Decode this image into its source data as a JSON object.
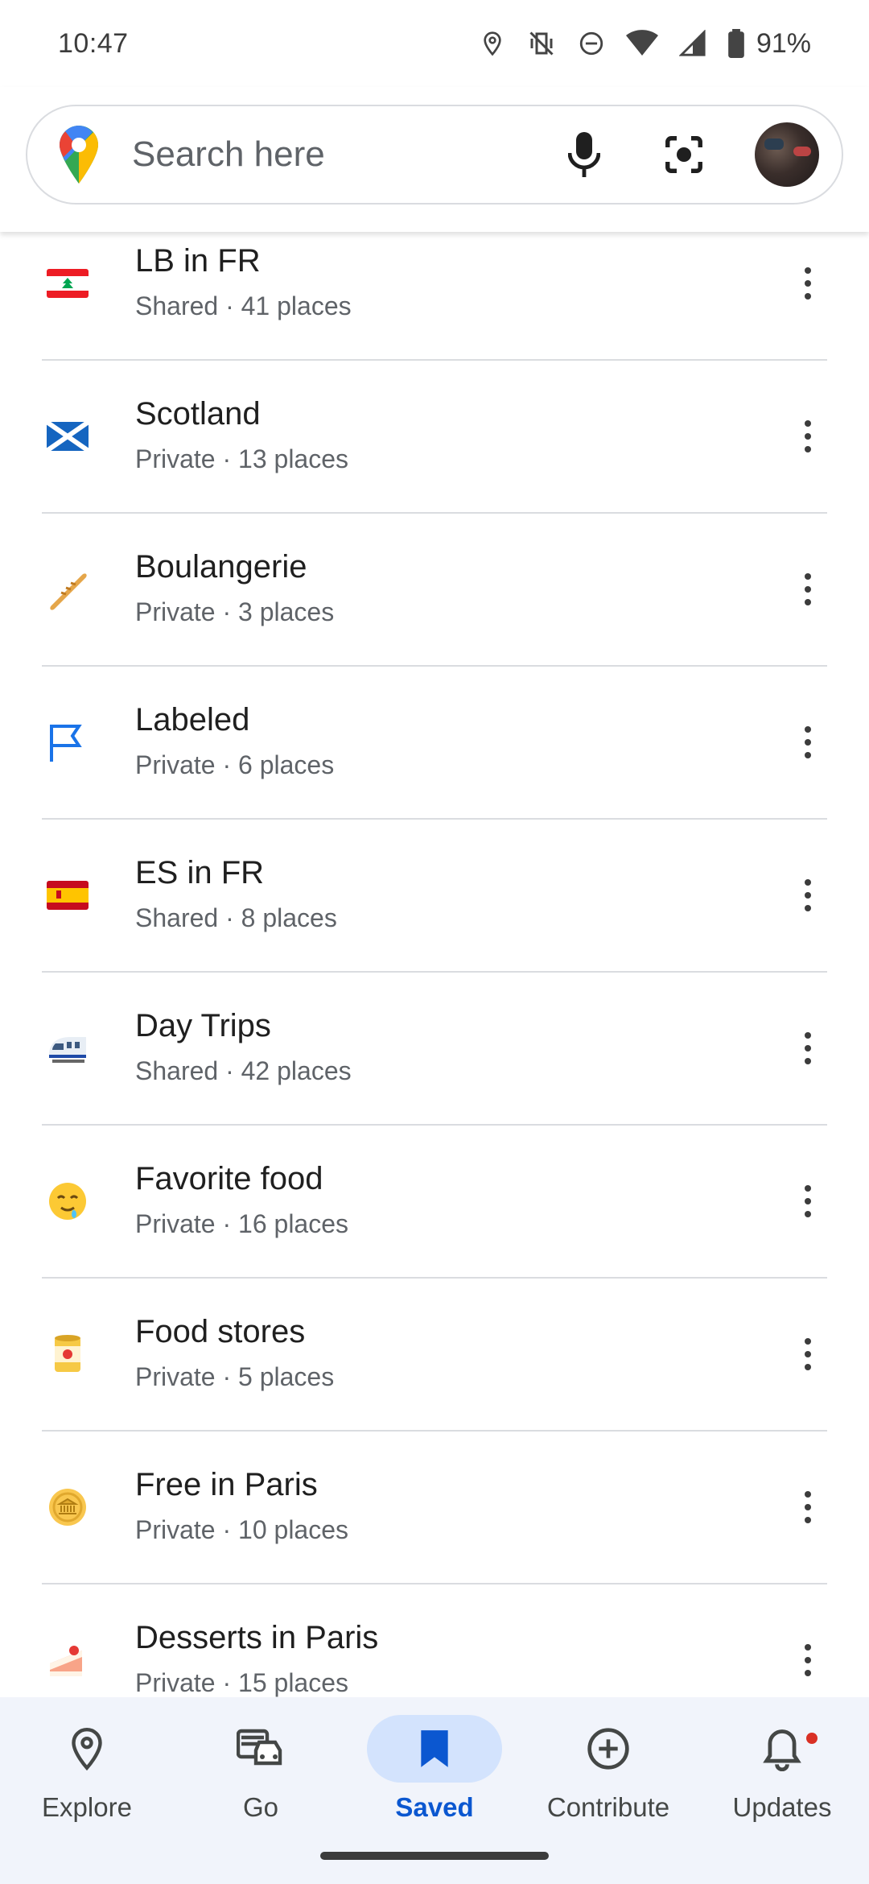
{
  "status_bar": {
    "time": "10:47",
    "battery": "91%"
  },
  "search": {
    "placeholder": "Search here"
  },
  "lists": [
    {
      "icon": "lebanon-flag-icon",
      "title": "LB in FR",
      "subtitle": "Shared · 41 places"
    },
    {
      "icon": "scotland-flag-icon",
      "title": "Scotland",
      "subtitle": "Private · 13 places"
    },
    {
      "icon": "baguette-icon",
      "title": "Boulangerie",
      "subtitle": "Private · 3 places"
    },
    {
      "icon": "label-flag-icon",
      "title": "Labeled",
      "subtitle": "Private · 6 places"
    },
    {
      "icon": "spain-flag-icon",
      "title": "ES in FR",
      "subtitle": "Shared · 8 places"
    },
    {
      "icon": "train-icon",
      "title": "Day Trips",
      "subtitle": "Shared · 42 places"
    },
    {
      "icon": "drooling-face-icon",
      "title": "Favorite food",
      "subtitle": "Private · 16 places"
    },
    {
      "icon": "canned-food-icon",
      "title": "Food stores",
      "subtitle": "Private · 5 places"
    },
    {
      "icon": "coin-icon",
      "title": "Free in Paris",
      "subtitle": "Private · 10 places"
    },
    {
      "icon": "cake-icon",
      "title": "Desserts in Paris",
      "subtitle": "Private · 15 places"
    }
  ],
  "bottom_nav": [
    {
      "label": "Explore",
      "icon": "location-pin-icon",
      "active": false
    },
    {
      "label": "Go",
      "icon": "car-icon",
      "active": false
    },
    {
      "label": "Saved",
      "icon": "bookmark-icon",
      "active": true
    },
    {
      "label": "Contribute",
      "icon": "add-circle-icon",
      "active": false
    },
    {
      "label": "Updates",
      "icon": "bell-icon",
      "active": false
    }
  ],
  "colors": {
    "accent": "#0b57d0",
    "active_pill": "#d3e3fd",
    "nav_background": "#f1f4fb",
    "notification_dot": "#d93025"
  }
}
